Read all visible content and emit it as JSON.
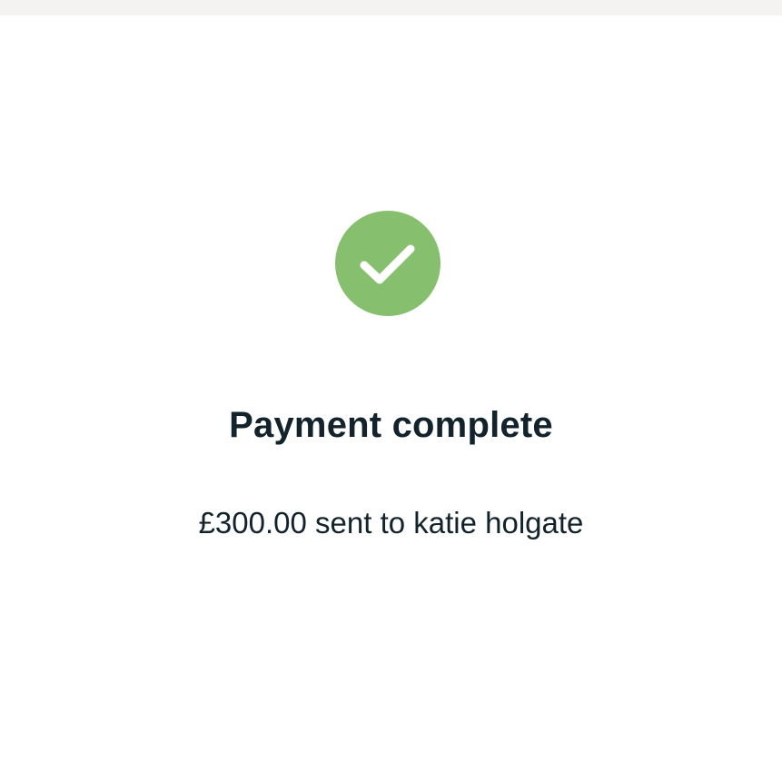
{
  "status": {
    "icon": "checkmark-icon",
    "badge_color": "#86bf6e",
    "title": "Payment complete",
    "message": "£300.00 sent to katie holgate"
  }
}
